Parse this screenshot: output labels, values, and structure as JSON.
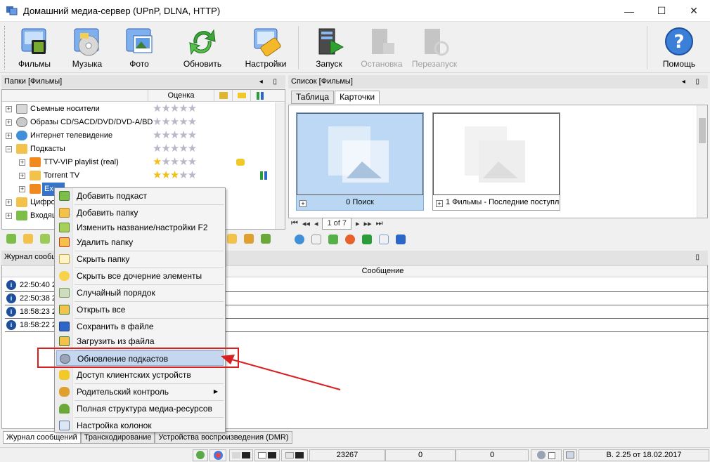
{
  "window": {
    "title": "Домашний медиа-сервер (UPnP, DLNA, HTTP)",
    "minimize": "—",
    "maximize": "☐",
    "close": "✕"
  },
  "toolbar": {
    "buttons": [
      {
        "label": "Фильмы",
        "icon": "films-icon"
      },
      {
        "label": "Музыка",
        "icon": "music-icon"
      },
      {
        "label": "Фото",
        "icon": "photo-icon"
      },
      {
        "label": "Обновить",
        "icon": "refresh-icon"
      },
      {
        "label": "Настройки",
        "icon": "settings-icon"
      },
      {
        "label": "Запуск",
        "icon": "start-icon"
      },
      {
        "label": "Остановка",
        "icon": "stop-icon",
        "disabled": true
      },
      {
        "label": "Перезапуск",
        "icon": "restart-icon",
        "disabled": true
      },
      {
        "label": "Помощь",
        "icon": "help-icon"
      }
    ]
  },
  "folders_panel": {
    "title": "Папки [Фильмы]",
    "pin": "◂ ▯",
    "columns": {
      "rating": "Оценка"
    },
    "items": [
      {
        "name": "Съемные носители",
        "stars": 0
      },
      {
        "name": "Образы CD/SACD/DVD/DVD-A/BD",
        "stars": 0
      },
      {
        "name": "Интернет телевидение",
        "stars": 0
      },
      {
        "name": "Подкасты",
        "stars": 0
      },
      {
        "name": "TTV-VIP playlist (real)",
        "stars": 1
      },
      {
        "name": "Torrent TV",
        "stars": 3
      },
      {
        "name": "Ex-...",
        "stars": 0
      },
      {
        "name": "Цифро...",
        "stars": 0
      },
      {
        "name": "Входящ...",
        "stars": 0
      }
    ],
    "tree_markers": {
      "collapse": "−",
      "expand": "+"
    }
  },
  "list_panel": {
    "title": "Список [Фильмы]",
    "pin": "◂ ▯",
    "tabs": [
      "Таблица",
      "Карточки"
    ],
    "active_tab": "Карточки",
    "cards": [
      {
        "caption": "0 Поиск",
        "expand": "+"
      },
      {
        "caption": "1 Фильмы - Последние поступле",
        "expand": "+"
      }
    ],
    "pager": {
      "first": "⏮",
      "prev_prev": "◂◂",
      "prev": "◂",
      "page": "1 of 7",
      "next": "▸",
      "next_next": "▸▸",
      "last": "⏭"
    }
  },
  "log_panel": {
    "title": "Журнал сообщений",
    "pin": "▯",
    "column": "Сообщение",
    "info_mark": "i",
    "rows": [
      {
        "time": "22:50:40 2"
      },
      {
        "time": "22:50:38 2"
      },
      {
        "time": "18:58:23 2"
      },
      {
        "time": "18:58:22 2"
      }
    ]
  },
  "context_menu": {
    "items": [
      {
        "label": "Добавить подкаст",
        "icon": "add-podcast-icon"
      },
      {
        "label": "Добавить папку",
        "icon": "add-folder-icon"
      },
      {
        "label": "Изменить название/настройки  F2",
        "icon": "rename-icon"
      },
      {
        "label": "Удалить папку",
        "icon": "delete-folder-icon"
      },
      {
        "label": "Скрыть папку",
        "icon": "hide-folder-icon"
      },
      {
        "label": "Скрыть все дочерние элементы",
        "icon": "hide-children-icon"
      },
      {
        "label": "Случайный порядок",
        "icon": "random-order-icon"
      },
      {
        "label": "Открыть все",
        "icon": "open-all-icon"
      },
      {
        "label": "Сохранить в файле",
        "icon": "save-file-icon"
      },
      {
        "label": "Загрузить из файла",
        "icon": "load-file-icon"
      },
      {
        "label": "Обновление подкастов",
        "icon": "update-podcasts-icon",
        "highlighted": true
      },
      {
        "label": "Доступ клиентских устройств",
        "icon": "client-access-icon"
      },
      {
        "label": "Родительский контроль",
        "icon": "parental-control-icon",
        "submenu": true
      },
      {
        "label": "Полная структура медиа-ресурсов",
        "icon": "media-structure-icon"
      },
      {
        "label": "Настройка колонок",
        "icon": "columns-icon"
      }
    ],
    "submenu_arrow": "▶"
  },
  "bottom_tabs": [
    "Журнал сообщений",
    "Транскодирование",
    "Устройства воспроизведения (DMR)"
  ],
  "status": {
    "count": "23267",
    "val1": "0",
    "val2": "0",
    "version": "В. 2.25 от 18.02.2017"
  },
  "colors": {
    "highlight": "#c5d7ee",
    "selection": "#b9d7f3",
    "annotation": "#d92020",
    "star_on": "#f2c01a",
    "star_off": "#b8b8c8"
  }
}
